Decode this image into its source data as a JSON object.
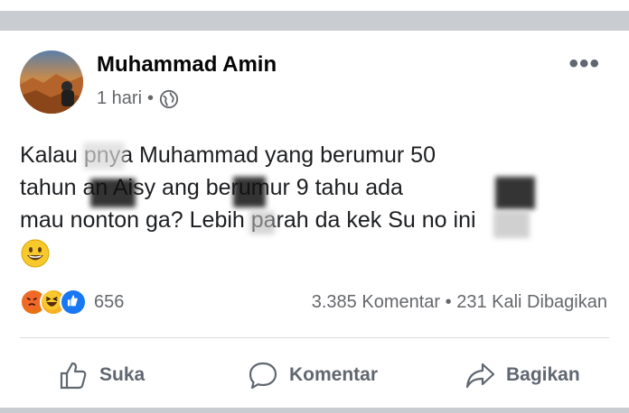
{
  "post": {
    "author_name": "Muhammad Amin",
    "timestamp": "1 hari",
    "separator": "•",
    "privacy_icon": "globe-icon",
    "more_options": "•••",
    "text_lines": [
      "Kalau       pnya Muhammad yang berumur 50",
      "tahun         an Aisy         ang berumur 9 tahu        ada",
      "mau nonton ga? Lebih parah da       kek Su      no ini"
    ],
    "trailing_emoji": "grinning-face-emoji",
    "reactions": {
      "icons": [
        "angry-reaction-icon",
        "haha-reaction-icon",
        "like-reaction-icon"
      ],
      "count": "656"
    },
    "stats": {
      "comments": "3.385 Komentar",
      "dot": "•",
      "shares": "231 Kali Dibagikan"
    },
    "actions": {
      "like_label": "Suka",
      "comment_label": "Komentar",
      "share_label": "Bagikan"
    }
  }
}
